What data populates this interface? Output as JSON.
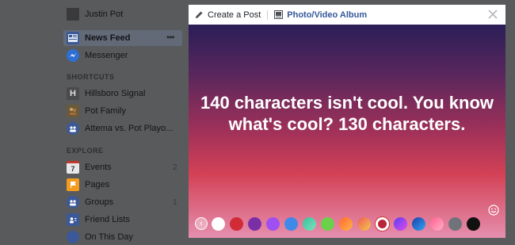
{
  "sidebar": {
    "profile_name": "Justin Pot",
    "news_feed": "News Feed",
    "more": "•••",
    "messenger": "Messenger",
    "shortcuts_header": "SHORTCUTS",
    "shortcuts": [
      "Hillsboro Signal",
      "Pot Family",
      "Attema vs. Pot Playo..."
    ],
    "explore_header": "EXPLORE",
    "explore": [
      {
        "label": "Events",
        "count": "2"
      },
      {
        "label": "Pages",
        "count": ""
      },
      {
        "label": "Groups",
        "count": "1"
      },
      {
        "label": "Friend Lists",
        "count": ""
      },
      {
        "label": "On This Day",
        "count": ""
      }
    ],
    "events_day": "7"
  },
  "modal": {
    "tab_create": "Create a Post",
    "tab_album": "Photo/Video Album",
    "close": "×",
    "post_text": "140 characters isn't cool. You know what's cool? 130 characters.",
    "back": "‹"
  },
  "colors": {
    "accent_link": "#365899",
    "swatches": [
      "#ffffff",
      "#d02b36",
      "#7b2fa6",
      "#a04ff0",
      "#3f8ae8",
      "#3ac09a",
      "#6bd14a",
      "#ff8a2e",
      "#f2a93b",
      "#ffffff",
      "#8a4dfc",
      "#2d74f0",
      "#ff6b9b",
      "#707379",
      "#111111"
    ]
  },
  "icons": [
    "pencil-icon",
    "album-icon",
    "close-icon",
    "emoji-icon",
    "back-arrow-icon"
  ]
}
